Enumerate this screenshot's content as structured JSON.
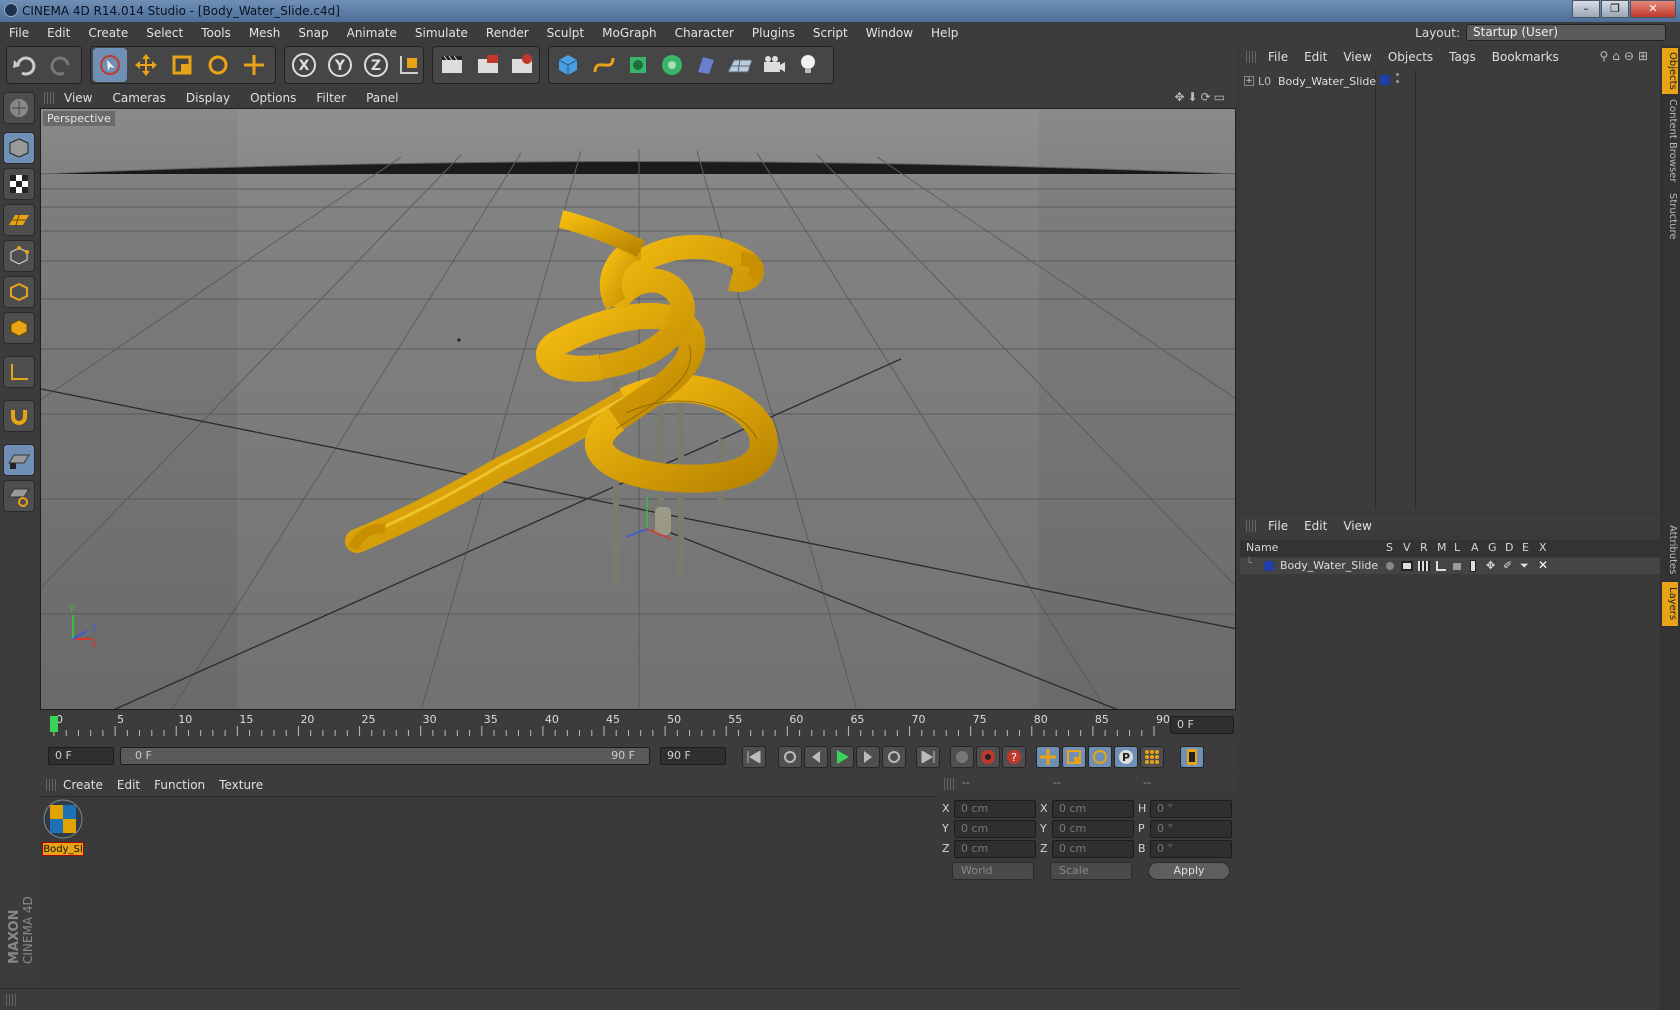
{
  "window": {
    "title": "CINEMA 4D R14.014 Studio - [Body_Water_Slide.c4d]",
    "controls": {
      "minimize": "–",
      "maximize": "❐",
      "close": "✕"
    }
  },
  "menubar": {
    "items": [
      "File",
      "Edit",
      "Create",
      "Select",
      "Tools",
      "Mesh",
      "Snap",
      "Animate",
      "Simulate",
      "Render",
      "Sculpt",
      "MoGraph",
      "Character",
      "Plugins",
      "Script",
      "Window",
      "Help"
    ],
    "layout_label": "Layout:",
    "layout_value": "Startup (User)"
  },
  "toolbar": {
    "axis_x": "X",
    "axis_y": "Y",
    "axis_z": "Z"
  },
  "viewport": {
    "menu": [
      "View",
      "Cameras",
      "Display",
      "Options",
      "Filter",
      "Panel"
    ],
    "label": "Perspective",
    "axis": {
      "y": "Y",
      "z": "Z",
      "x": "X"
    }
  },
  "timeline": {
    "ticks": [
      "0",
      "5",
      "10",
      "15",
      "20",
      "25",
      "30",
      "35",
      "40",
      "45",
      "50",
      "55",
      "60",
      "65",
      "70",
      "75",
      "80",
      "85",
      "90"
    ],
    "frame_field": "0 F"
  },
  "playback": {
    "start_field": "0 F",
    "slider_left": "0 F",
    "slider_right": "90 F",
    "end_field": "90 F",
    "record_button": "P"
  },
  "material": {
    "menu": [
      "Create",
      "Edit",
      "Function",
      "Texture"
    ],
    "items": [
      {
        "label": "Body_Sl"
      }
    ]
  },
  "coords": {
    "headers": [
      "--",
      "--",
      "--"
    ],
    "rows": [
      {
        "a": "X",
        "av": "0 cm",
        "b": "X",
        "bv": "0 cm",
        "c": "H",
        "cv": "0 °"
      },
      {
        "a": "Y",
        "av": "0 cm",
        "b": "Y",
        "bv": "0 cm",
        "c": "P",
        "cv": "0 °"
      },
      {
        "a": "Z",
        "av": "0 cm",
        "b": "Z",
        "bv": "0 cm",
        "c": "B",
        "cv": "0 °"
      }
    ],
    "world": "World",
    "scale": "Scale",
    "apply": "Apply"
  },
  "objects": {
    "menu": [
      "File",
      "Edit",
      "View",
      "Objects",
      "Tags",
      "Bookmarks"
    ],
    "items": [
      {
        "name": "Body_Water_Slide",
        "color": "#1f3fa8"
      }
    ]
  },
  "layers": {
    "menu": [
      "File",
      "Edit",
      "View"
    ],
    "columns": {
      "name": "Name",
      "flags": [
        "S",
        "V",
        "R",
        "M",
        "L",
        "A",
        "G",
        "D",
        "E",
        "X"
      ]
    },
    "items": [
      {
        "name": "Body_Water_Slide",
        "color": "#1f3fa8"
      }
    ]
  },
  "sidetabs": {
    "top": [
      "Objects",
      "Content Browser",
      "Structure"
    ],
    "bottom": [
      "Attributes",
      "Layers"
    ]
  },
  "brand": {
    "line1": "MAXON",
    "line2": "CINEMA 4D"
  },
  "colors": {
    "accent": "#e8a317",
    "slide": "#e0a300",
    "selection": "#6f8fb5"
  }
}
